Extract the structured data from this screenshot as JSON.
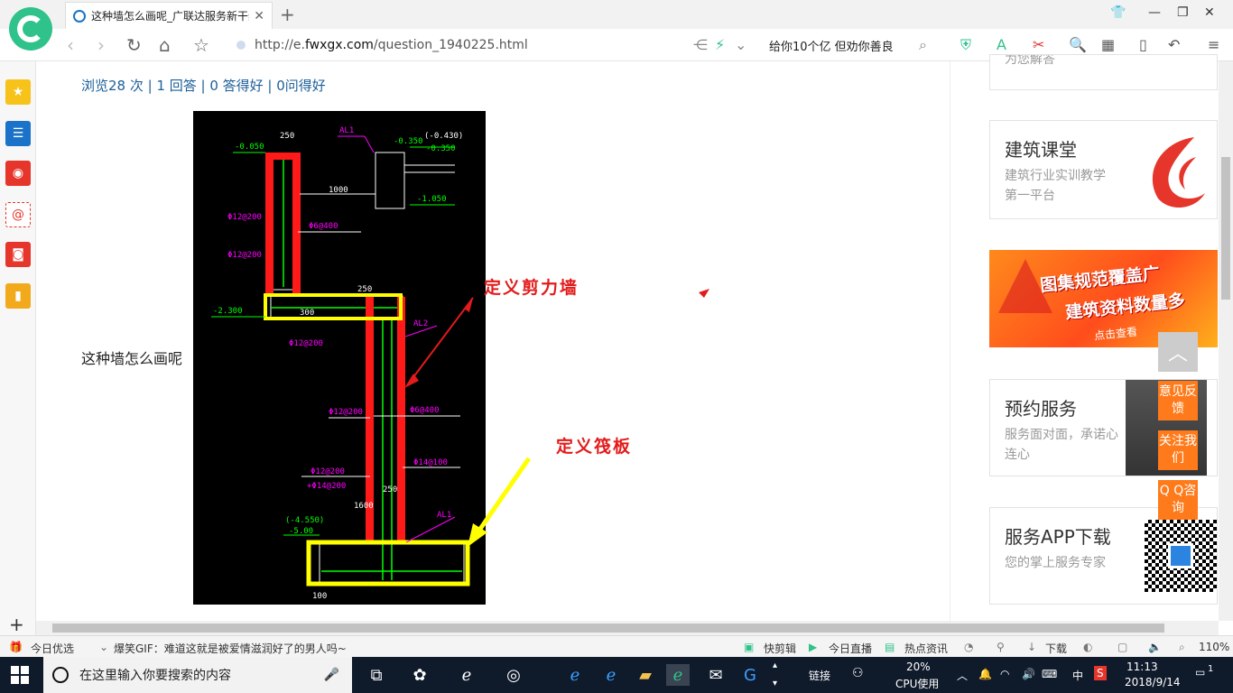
{
  "browser": {
    "tab_title": "这种墙怎么画呢_广联达服务新干线",
    "tab_close": "✕",
    "new_tab": "+",
    "url_domain": "http://e.",
    "url_host": "fwxgx.com",
    "url_path": "/question_1940225.html",
    "search_text": "给你10个亿 但劝你善良"
  },
  "page": {
    "stats": "浏览28 次 | 1 回答 | 0 答得好 | 0问得好",
    "question_text": "这种墙怎么画呢",
    "annotation_wall": "定义剪力墙",
    "annotation_raft": "定义筏板"
  },
  "cad_labels": {
    "w250_top": "250",
    "m0050": "-0.050",
    "al1_top": "AL1",
    "m0350": "-0.350",
    "m0430": "(-0.430)",
    "m0350b": "-0.350",
    "d1000": "1000",
    "m1050": "-1.050",
    "r12_200a": "Φ12@200",
    "r6_400a": "Φ6@400",
    "r12_200b": "Φ12@200",
    "m2300": "-2.300",
    "d300": "300",
    "d250v": "250",
    "al2": "AL2",
    "r12_200c": "Φ12@200",
    "r6_400b": "Φ6@400",
    "r12_200d": "Φ12@200",
    "r14_100": "Φ14@100",
    "r12_200e": "Φ12@200",
    "r14_200": "+Φ14@200",
    "d1600": "1600",
    "w250_bot": "250",
    "m4550": "(-4.550)",
    "m5000": "-5.00",
    "al1_bot": "AL1",
    "d100": "100"
  },
  "sidebar_cards": [
    {
      "title": "",
      "subtitle": "为您解答"
    },
    {
      "title": "建筑课堂",
      "subtitle": "建筑行业实训教学第一平台"
    },
    {
      "title": "预约服务",
      "subtitle": "服务面对面，承诺心连心"
    },
    {
      "title": "服务APP下载",
      "subtitle": "您的掌上服务专家"
    }
  ],
  "banner": {
    "line1": "图集规范覆盖广",
    "line2": "建筑资料数量多",
    "cta": "点击查看"
  },
  "float_tools": {
    "feedback": "意见反馈",
    "follow": "关注我们",
    "qq": "Q Q咨询",
    "to_top": "︿"
  },
  "statusbar": {
    "today": "今日优选",
    "news": "爆笑GIF：难道这就是被爱情滋润好了的男人吗~",
    "clip": "快剪辑",
    "live": "今日直播",
    "hot": "热点资讯",
    "download": "下载",
    "zoom": "110%"
  },
  "taskbar": {
    "search_placeholder": "在这里输入你要搜索的内容",
    "link": "链接",
    "cpu_pct": "20%",
    "cpu_label": "CPU使用",
    "lang": "中",
    "time": "11:13",
    "date": "2018/9/14",
    "notif": "1"
  },
  "colors": {
    "accent_green": "#2fc28a",
    "link_blue": "#1d5f99",
    "annotation_red": "#e31b1b",
    "orange": "#ff7a1a"
  }
}
